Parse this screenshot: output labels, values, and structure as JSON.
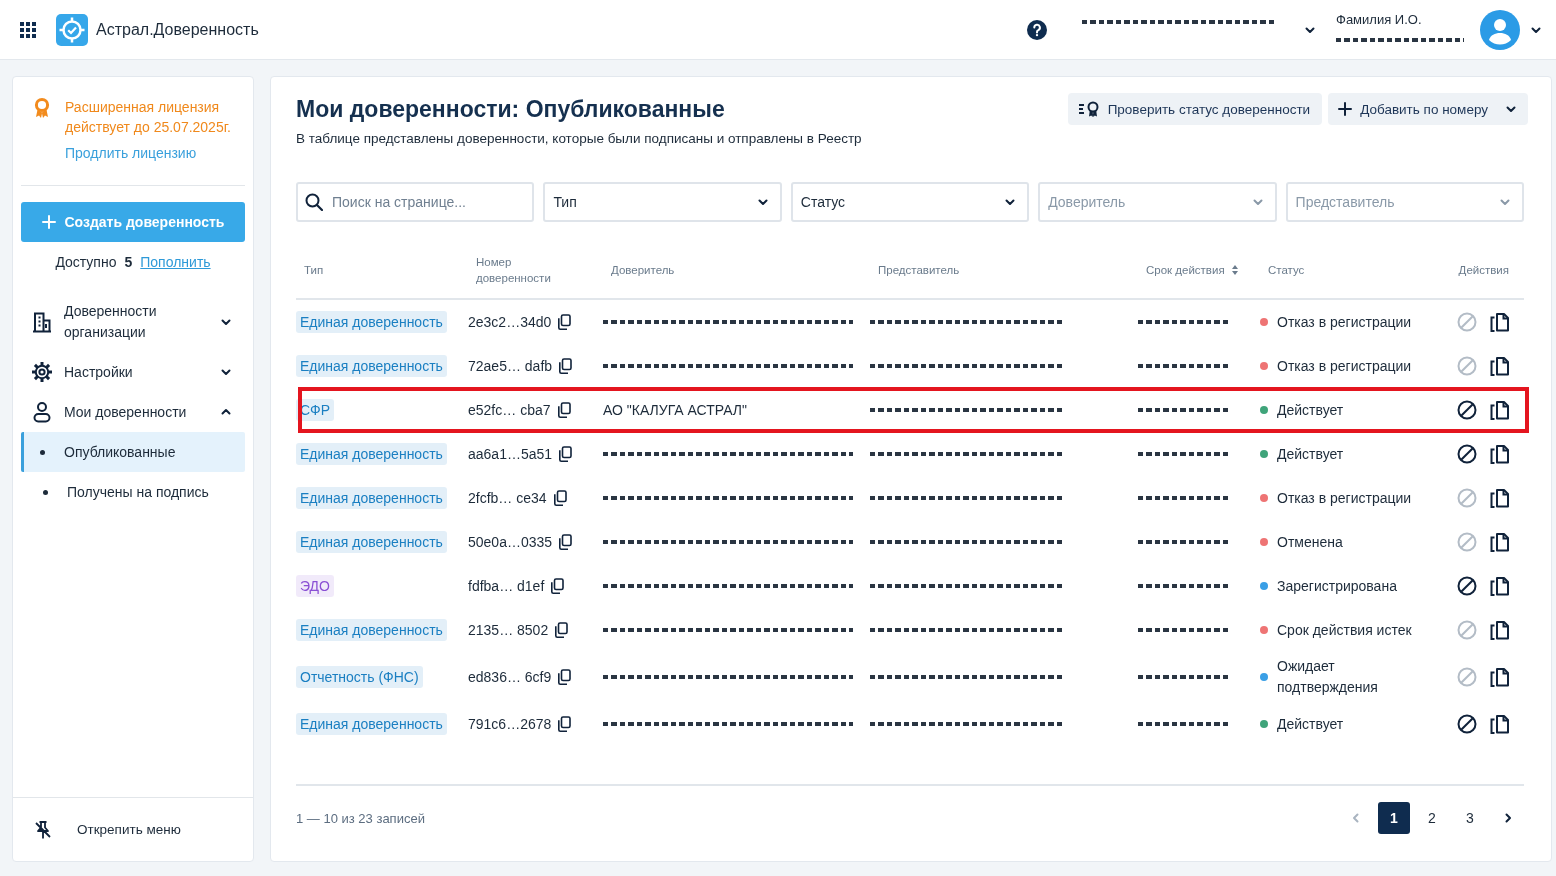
{
  "header": {
    "app_name": "Астрал.Доверенность",
    "organization": {
      "redacted": true
    },
    "user_name": "Фамилия И.О.",
    "user_email": {
      "redacted": true
    }
  },
  "sidebar": {
    "license": {
      "title": "Расширенная лицензия",
      "expiry": "действует до 25.07.2025г.",
      "link": "Продлить лицензию"
    },
    "create_button": "Создать доверенность",
    "available": {
      "label": "Доступно",
      "count": "5",
      "link": "Пополнить"
    },
    "nav": [
      {
        "kind": "building",
        "label": "Доверенности организации",
        "expanded": false
      },
      {
        "kind": "gear",
        "label": "Настройки",
        "expanded": false
      },
      {
        "kind": "person",
        "label": "Мои доверенности",
        "expanded": true,
        "children": [
          {
            "label": "Опубликованные",
            "selected": true
          },
          {
            "label": "Получены на подпись",
            "selected": false
          }
        ]
      }
    ],
    "unpin": "Открепить меню"
  },
  "page": {
    "title": "Мои доверенности: Опубликованные",
    "subtitle": "В таблице представлены доверенности, которые были подписаны и отправлены в Реестр",
    "actions": [
      {
        "kind": "check",
        "label": "Проверить статус доверенности"
      },
      {
        "kind": "add",
        "label": "Добавить по номеру"
      }
    ]
  },
  "filters": [
    {
      "kind": "search",
      "placeholder": "Поиск на странице..."
    },
    {
      "kind": "select",
      "label": "Тип",
      "disabled": false
    },
    {
      "kind": "select",
      "label": "Статус",
      "disabled": false
    },
    {
      "kind": "select",
      "label": "Доверитель",
      "disabled": true
    },
    {
      "kind": "select",
      "label": "Представитель",
      "disabled": true
    }
  ],
  "table": {
    "columns": [
      {
        "label": "Тип",
        "sortable": false
      },
      {
        "label": "Номер доверенности",
        "sortable": false
      },
      {
        "label": "Доверитель",
        "sortable": false
      },
      {
        "label": "Представитель",
        "sortable": false
      },
      {
        "label": "Срок действия",
        "sortable": true
      },
      {
        "label": "Статус",
        "sortable": false
      },
      {
        "label": "Действия",
        "sortable": false
      }
    ],
    "rows": [
      {
        "highlighted": false,
        "type": {
          "label": "Единая доверенность",
          "color": "#1a7fc2"
        },
        "number": "2e3c2…34d0",
        "principal": {
          "redacted": true
        },
        "representative": {
          "redacted": true
        },
        "term": {
          "redacted": true
        },
        "status": {
          "label": "Отказ в регистрации",
          "color": "#ee7474"
        },
        "revoke_disabled": true
      },
      {
        "highlighted": false,
        "type": {
          "label": "Единая доверенность",
          "color": "#1a7fc2"
        },
        "number": "72ae5… dafb",
        "principal": {
          "redacted": true
        },
        "representative": {
          "redacted": true
        },
        "term": {
          "redacted": true
        },
        "status": {
          "label": "Отказ в регистрации",
          "color": "#ee7474"
        },
        "revoke_disabled": true
      },
      {
        "highlighted": true,
        "type": {
          "label": "СФР",
          "color": "#1a7fc2"
        },
        "number": "e52fc… cba7",
        "principal": {
          "text": "АО \"КАЛУГА АСТРАЛ\""
        },
        "representative": {
          "redacted": true
        },
        "term": {
          "redacted": true
        },
        "status": {
          "label": "Действует",
          "color": "#3fa47a"
        },
        "revoke_disabled": false
      },
      {
        "highlighted": false,
        "type": {
          "label": "Единая доверенность",
          "color": "#1a7fc2"
        },
        "number": "aa6a1…5a51",
        "principal": {
          "redacted": true
        },
        "representative": {
          "redacted": true
        },
        "term": {
          "redacted": true
        },
        "status": {
          "label": "Действует",
          "color": "#3fa47a"
        },
        "revoke_disabled": false
      },
      {
        "highlighted": false,
        "type": {
          "label": "Единая доверенность",
          "color": "#1a7fc2"
        },
        "number": "2fcfb… ce34",
        "principal": {
          "redacted": true
        },
        "representative": {
          "redacted": true
        },
        "term": {
          "redacted": true
        },
        "status": {
          "label": "Отказ в регистрации",
          "color": "#ee7474"
        },
        "revoke_disabled": true
      },
      {
        "highlighted": false,
        "type": {
          "label": "Единая доверенность",
          "color": "#1a7fc2"
        },
        "number": "50e0a…0335",
        "principal": {
          "redacted": true
        },
        "representative": {
          "redacted": true
        },
        "term": {
          "redacted": true
        },
        "status": {
          "label": "Отменена",
          "color": "#ee7474"
        },
        "revoke_disabled": true
      },
      {
        "highlighted": false,
        "type": {
          "label": "ЭДО",
          "color": "#8a4fd4"
        },
        "number": "fdfba… d1ef",
        "principal": {
          "redacted": true
        },
        "representative": {
          "redacted": true
        },
        "term": {
          "redacted": true
        },
        "status": {
          "label": "Зарегистрирована",
          "color": "#3a9fe6"
        },
        "revoke_disabled": false
      },
      {
        "highlighted": false,
        "type": {
          "label": "Единая доверенность",
          "color": "#1a7fc2"
        },
        "number": "2135… 8502",
        "principal": {
          "redacted": true
        },
        "representative": {
          "redacted": true
        },
        "term": {
          "redacted": true
        },
        "status": {
          "label": "Срок действия истек",
          "color": "#ee7474"
        },
        "revoke_disabled": true
      },
      {
        "highlighted": false,
        "type": {
          "label": "Отчетность (ФНС)",
          "color": "#1a7fc2"
        },
        "number": "ed836… 6cf9",
        "principal": {
          "redacted": true
        },
        "representative": {
          "redacted": true
        },
        "term": {
          "redacted": true
        },
        "status": {
          "label": "Ожидает подтверждения",
          "color": "#3a9fe6"
        },
        "revoke_disabled": true
      },
      {
        "highlighted": false,
        "type": {
          "label": "Единая доверенность",
          "color": "#1a7fc2"
        },
        "number": "791c6…2678",
        "principal": {
          "redacted": true
        },
        "representative": {
          "redacted": true
        },
        "term": {
          "redacted": true
        },
        "status": {
          "label": "Действует",
          "color": "#3fa47a"
        },
        "revoke_disabled": false
      }
    ]
  },
  "pagination": {
    "summary": "1 — 10 из 23 записей",
    "prev_disabled": true,
    "pages": [
      {
        "label": "1",
        "selected": true
      },
      {
        "label": "2",
        "selected": false
      },
      {
        "label": "3",
        "selected": false
      }
    ]
  }
}
